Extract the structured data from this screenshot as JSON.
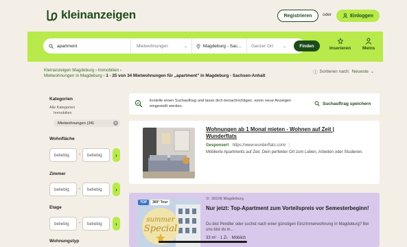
{
  "header": {
    "brand": "kleinanzeigen",
    "register_label": "Registrieren",
    "or_label": "oder",
    "login_label": "Einloggen",
    "colors": {
      "accent": "#b7ea4a",
      "brand_dark": "#1d4b1a",
      "background": "#f4efe6"
    }
  },
  "search": {
    "query": "apartment",
    "category": "Mietwohnungen",
    "location": "Magdeburg - Sac...",
    "radius": "Ganzer Ort",
    "submit_label": "Finden"
  },
  "nav": {
    "post_label": "Inserieren",
    "mine_label": "Meins"
  },
  "breadcrumb": {
    "crumb1": "Kleinanzeigen Magdeburg",
    "crumb2": "Immobilien",
    "crumb3": "Mietwohnungen in Magdeburg",
    "result_text": "1 - 25 von 34 Mietwohnungen für „apartment\" in Magdeburg - Sachsen-Anhalt"
  },
  "sort": {
    "label": "Sortieren nach:",
    "value": "Neueste"
  },
  "sidebar": {
    "categories_title": "Kategorien",
    "all_categories": "Alle Kategorien",
    "real_estate": "Immobilien",
    "active_chip": "Mietwohnungen (34)",
    "living_area_title": "Wohnfläche",
    "rooms_title": "Zimmer",
    "floor_title": "Etage",
    "apartment_type_title": "Wohnungstyp",
    "any_placeholder": "beliebig"
  },
  "alert": {
    "text": "Erstelle einen Suchauftrag und lasse dich benachrichtigen, wenn neue Anzeigen eingestellt werden.",
    "save_label": "Suchauftrag speichern"
  },
  "listings": [
    {
      "title": "Wohnungen ab 1 Monat mieten - Wohnen auf Zeit | Wunderflats",
      "sponsored": "Gesponsert",
      "url": "https://www.wunderflats.com/",
      "desc": "Möblierte Apartments auf Zeit. Dein perfekter Ort zum Leben, Arbeiten oder Studieren."
    },
    {
      "location": "39106 Magdeburg",
      "title": "Nur jetzt: Top-Apartment zum Vorteilspreis vor Semesterbeginn!",
      "desc": "Du bist Pendler oder suchst nach einer günstigen Einzimmerwohnung in Magdeburg? Bei uns bist du in...",
      "meta": "33 m² · 1 Zi. · Möblich",
      "badge_top": "TOP",
      "badge_tour": "360° Tour",
      "promo_line1": "summer",
      "promo_line2": "Special"
    }
  ]
}
